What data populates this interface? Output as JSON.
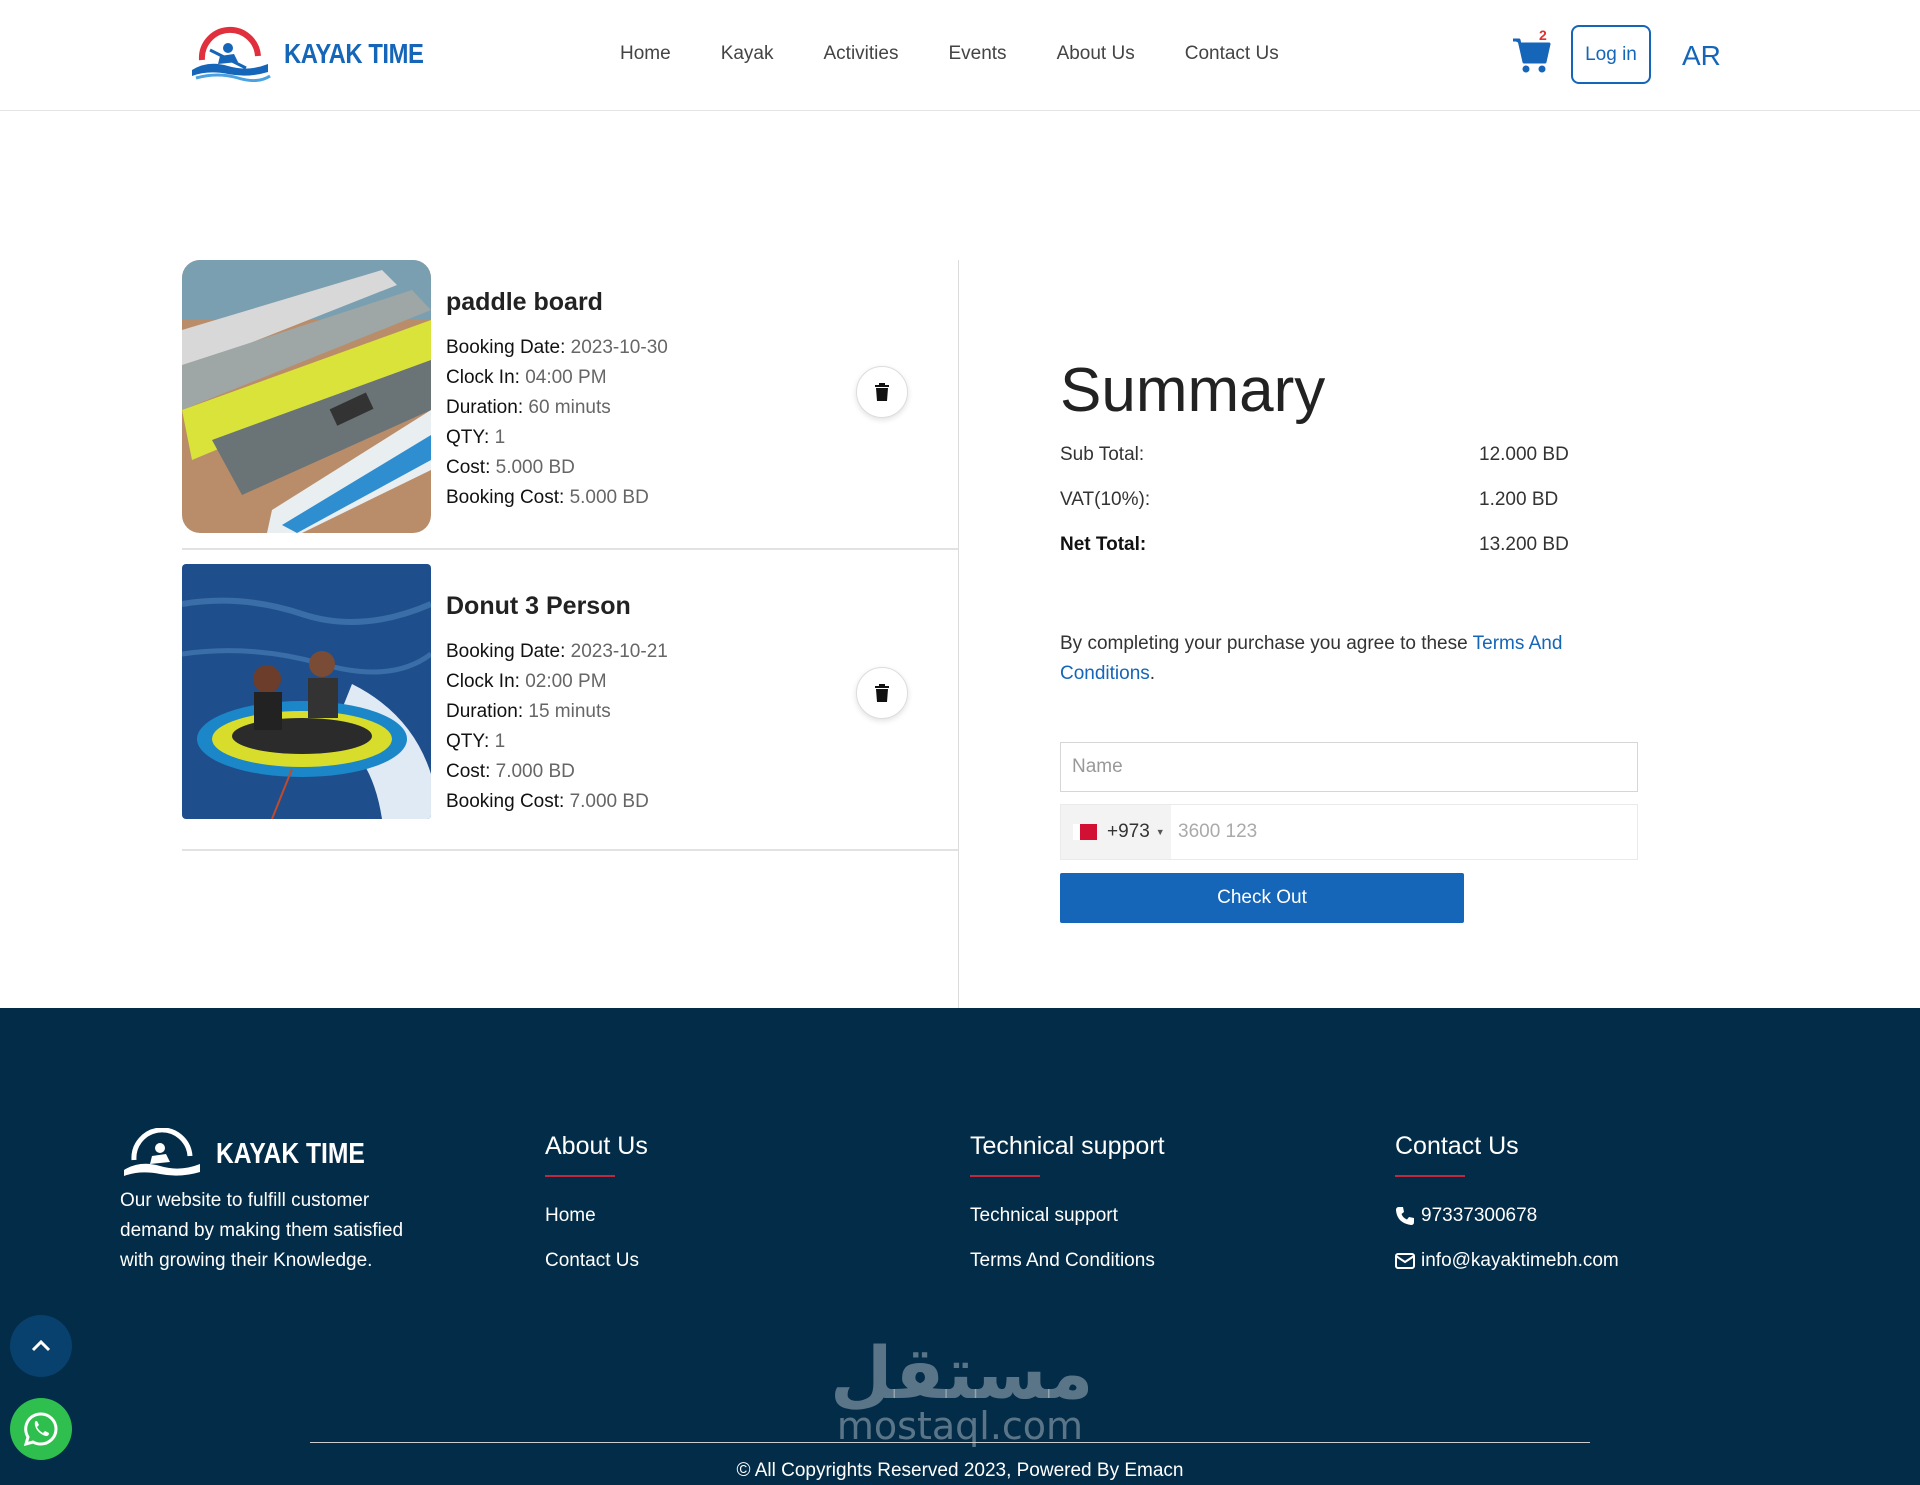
{
  "header": {
    "logo_text": "KAYAK TIME",
    "nav": [
      "Home",
      "Kayak",
      "Activities",
      "Events",
      "About Us",
      "Contact Us"
    ],
    "cart_count": "2",
    "login_label": "Log in",
    "lang_label": "AR"
  },
  "items": [
    {
      "title": "paddle board",
      "booking_date_label": "Booking Date:",
      "booking_date": "2023-10-30",
      "clock_in_label": "Clock In:",
      "clock_in": "04:00 PM",
      "duration_label": "Duration:",
      "duration": "60 minuts",
      "qty_label": "QTY:",
      "qty": "1",
      "cost_label": "Cost:",
      "cost": "5.000 BD",
      "booking_cost_label": "Booking Cost:",
      "booking_cost": "5.000 BD"
    },
    {
      "title": "Donut 3 Person",
      "booking_date_label": "Booking Date:",
      "booking_date": "2023-10-21",
      "clock_in_label": "Clock In:",
      "clock_in": "02:00 PM",
      "duration_label": "Duration:",
      "duration": "15 minuts",
      "qty_label": "QTY:",
      "qty": "1",
      "cost_label": "Cost:",
      "cost": "7.000 BD",
      "booking_cost_label": "Booking Cost:",
      "booking_cost": "7.000 BD"
    }
  ],
  "summary": {
    "title": "Summary",
    "subtotal_label": "Sub Total:",
    "subtotal": "12.000 BD",
    "vat_label": "VAT(10%):",
    "vat": "1.200 BD",
    "net_label": "Net Total:",
    "net": "13.200 BD",
    "terms_prefix": "By completing your purchase you agree to these ",
    "terms_link": "Terms And Conditions",
    "terms_suffix": ".",
    "name_placeholder": "Name",
    "country_code": "+973",
    "phone_placeholder": "3600 123",
    "checkout_label": "Check Out"
  },
  "footer": {
    "logo_text": "KAYAK TIME",
    "description": "Our website to fulfill customer demand by making them satisfied with growing their Knowledge.",
    "about": {
      "title": "About Us",
      "links": [
        "Home",
        "Contact Us"
      ]
    },
    "support": {
      "title": "Technical support",
      "links": [
        "Technical support",
        "Terms And Conditions"
      ]
    },
    "contact": {
      "title": "Contact Us",
      "phone": "97337300678",
      "email": "info@kayaktimebh.com"
    },
    "copyright": "© All Copyrights Reserved 2023, Powered By Emacn",
    "watermark_ar": "مستقل",
    "watermark_en": "mostaql.com"
  },
  "colors": {
    "brand": "#1565b8",
    "footer_bg": "#022c47",
    "accent_red": "#c0293b",
    "whatsapp": "#2fbf4f"
  },
  "icons": [
    "cart-icon",
    "trash-icon",
    "phone-icon",
    "envelope-icon",
    "chevron-up-icon",
    "whatsapp-icon"
  ]
}
